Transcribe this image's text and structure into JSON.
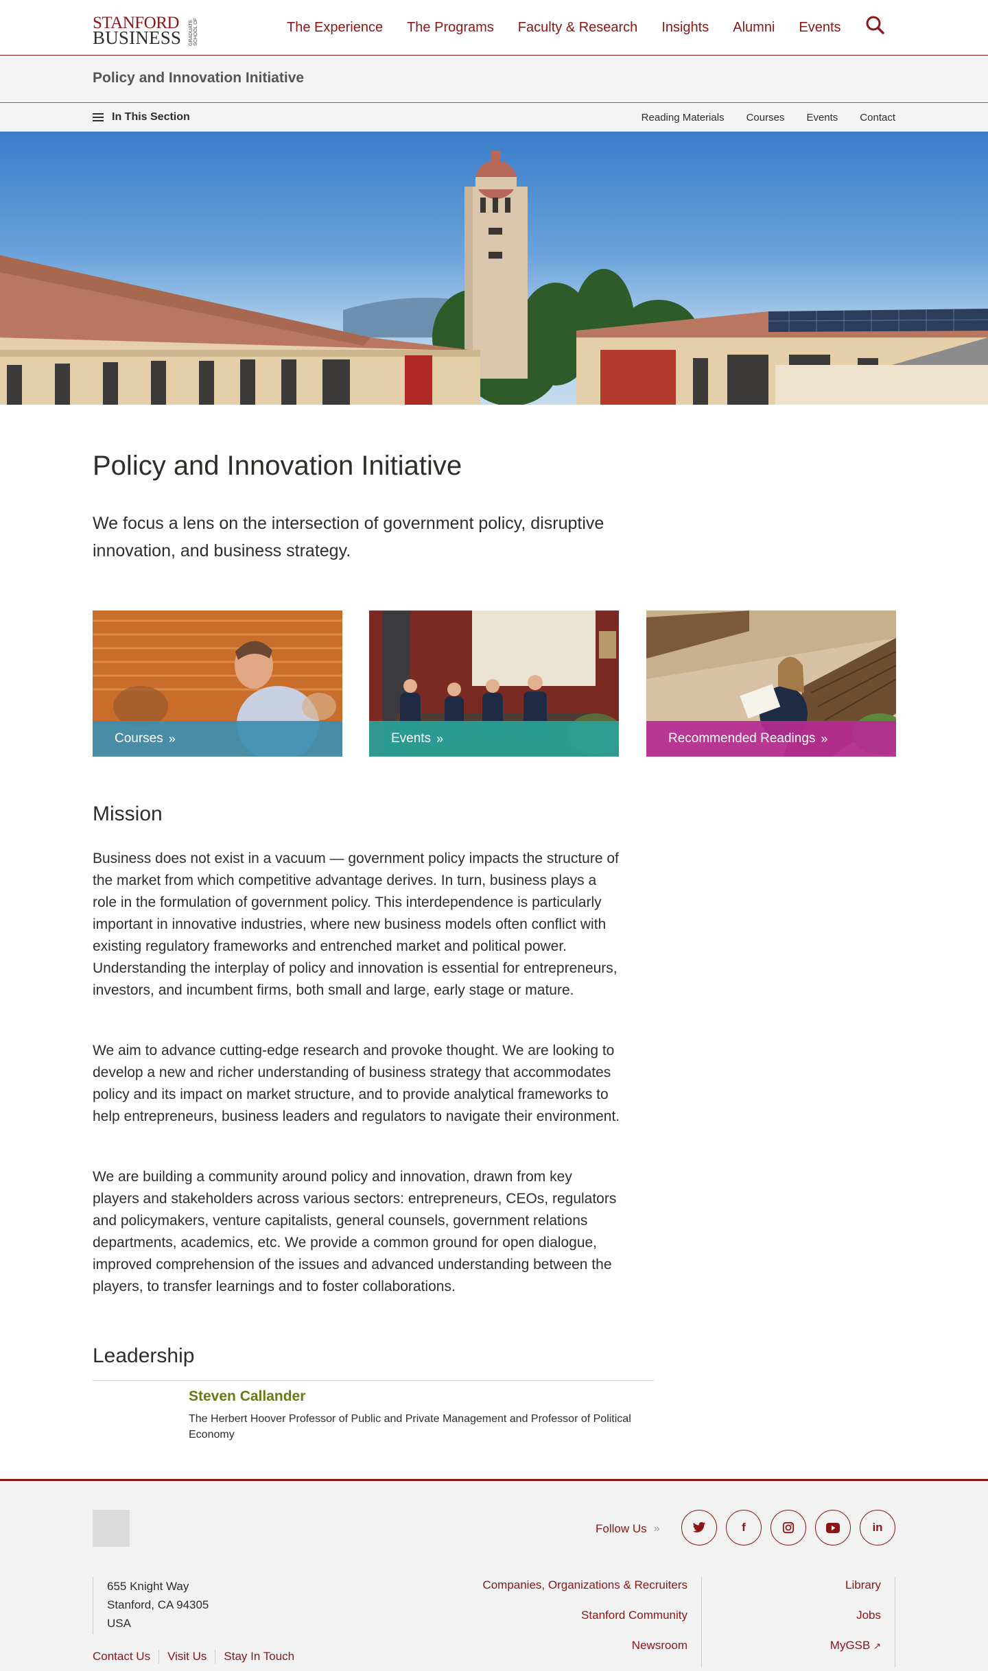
{
  "header": {
    "logo_line1": "STANFORD",
    "logo_line2": "BUSINESS",
    "logo_side": "GRADUATE SCHOOL OF",
    "nav": [
      "The Experience",
      "The Programs",
      "Faculty & Research",
      "Insights",
      "Alumni",
      "Events"
    ],
    "search_icon": "search-icon"
  },
  "section": {
    "title": "Policy and Innovation Initiative",
    "menu_label": "In This Section",
    "links": [
      "Reading Materials",
      "Courses",
      "Events",
      "Contact"
    ]
  },
  "page": {
    "title": "Policy and Innovation Initiative",
    "intro": "We focus a lens on the intersection of government policy, disruptive innovation, and business strategy."
  },
  "cards": [
    {
      "label": "Courses",
      "color": "#3d8fb0"
    },
    {
      "label": "Events",
      "color": "#2aa39a"
    },
    {
      "label": "Recommended Readings",
      "color": "#b52b92"
    }
  ],
  "mission": {
    "heading": "Mission",
    "paragraphs": [
      "Business does not exist in a vacuum — government policy impacts the structure of the market from which competitive advantage derives. In turn, business plays a role in the formulation of government policy. This interdependence is particularly important in innovative industries, where new business models often conflict with existing regulatory frameworks and entrenched market and political power. Understanding the interplay of policy and innovation is essential for entrepreneurs, investors, and incumbent firms, both small and large, early stage or mature.",
      "We aim to advance cutting-edge research and provoke thought. We are looking to develop a new and richer understanding of business strategy that accommodates policy and its impact on market structure, and to provide analytical frameworks to help entrepreneurs, business leaders and regulators to navigate their environment.",
      "We are building a community around policy and innovation, drawn from key players and stakeholders across various sectors: entrepreneurs, CEOs, regulators and policymakers, venture capitalists, general counsels, government relations departments, academics, etc. We provide a common ground for open dialogue, improved comprehension of the issues and advanced understanding between the players, to transfer learnings and to foster collaborations."
    ]
  },
  "leadership": {
    "heading": "Leadership",
    "name": "Steven Callander",
    "title": "The Herbert Hoover Professor of Public and Private Management and Professor of Political Economy"
  },
  "footer": {
    "follow": "Follow Us",
    "social": [
      "twitter-icon",
      "facebook-icon",
      "instagram-icon",
      "youtube-icon",
      "linkedin-icon"
    ],
    "address": [
      "655 Knight Way",
      "Stanford, CA 94305",
      "USA"
    ],
    "col1": [
      "Companies, Organizations & Recruiters",
      "Stanford Community",
      "Newsroom"
    ],
    "col2": [
      "Library",
      "Jobs",
      "MyGSB"
    ],
    "bottom_links": [
      "Contact Us",
      "Visit Us",
      "Stay In Touch"
    ]
  },
  "colors": {
    "brand": "#8c1515",
    "name_accent": "#6a7a12"
  }
}
